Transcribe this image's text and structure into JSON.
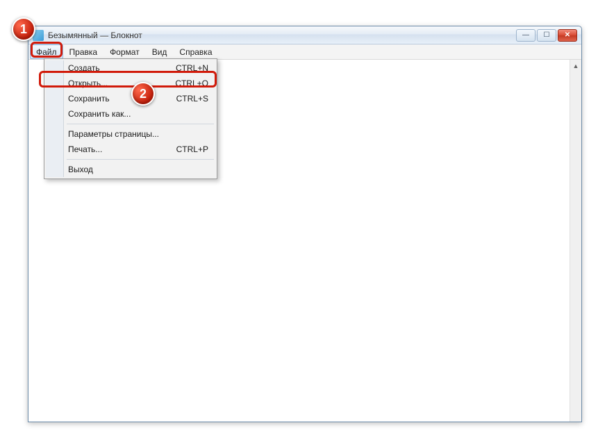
{
  "window": {
    "title": "Безымянный — Блокнот"
  },
  "menubar": {
    "items": [
      {
        "label": "Файл"
      },
      {
        "label": "Правка"
      },
      {
        "label": "Формат"
      },
      {
        "label": "Вид"
      },
      {
        "label": "Справка"
      }
    ]
  },
  "dropdown": {
    "items": [
      {
        "label": "Создать",
        "shortcut": "CTRL+N"
      },
      {
        "label": "Открыть...",
        "shortcut": "CTRL+O"
      },
      {
        "label": "Сохранить",
        "shortcut": "CTRL+S"
      },
      {
        "label": "Сохранить как...",
        "shortcut": ""
      },
      {
        "sep": true
      },
      {
        "label": "Параметры страницы...",
        "shortcut": ""
      },
      {
        "label": "Печать...",
        "shortcut": "CTRL+P"
      },
      {
        "sep": true
      },
      {
        "label": "Выход",
        "shortcut": ""
      }
    ]
  },
  "callouts": {
    "one": "1",
    "two": "2"
  },
  "winbuttons": {
    "min": "—",
    "max": "☐",
    "close": "✕"
  }
}
